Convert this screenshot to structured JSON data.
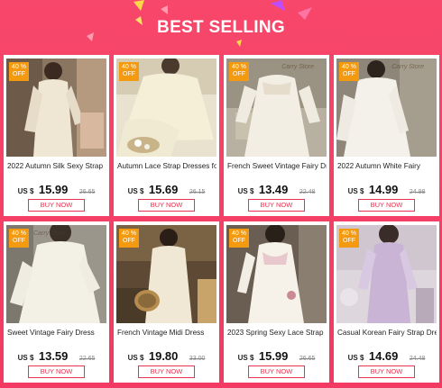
{
  "header": {
    "title": "BEST SELLING"
  },
  "watermark": "Carry Store",
  "currency": "US $",
  "buy_label": "BUY NOW",
  "colors": {
    "accent": "#f23a62",
    "badge": "#f39a10"
  },
  "products": [
    {
      "discount": "40 %",
      "off": "OFF",
      "name": "2022 Autumn Silk Sexy Strap",
      "price": "15.99",
      "old_price": "26.65"
    },
    {
      "discount": "40 %",
      "off": "OFF",
      "name": "Autumn Lace Strap Dresses for",
      "price": "15.69",
      "old_price": "26.15"
    },
    {
      "discount": "40 %",
      "off": "OFF",
      "name": "French Sweet Vintage Fairy Dress",
      "price": "13.49",
      "old_price": "22.48"
    },
    {
      "discount": "40 %",
      "off": "OFF",
      "name": "2022 Autumn White Fairy",
      "price": "14.99",
      "old_price": "24.98"
    },
    {
      "discount": "40 %",
      "off": "OFF",
      "name": "Sweet Vintage Fairy Dress",
      "price": "13.59",
      "old_price": "22.65"
    },
    {
      "discount": "40 %",
      "off": "OFF",
      "name": "French Vintage Midi Dress",
      "price": "19.80",
      "old_price": "33.00"
    },
    {
      "discount": "40 %",
      "off": "OFF",
      "name": "2023 Spring Sexy Lace Strap",
      "price": "15.99",
      "old_price": "26.65"
    },
    {
      "discount": "40 %",
      "off": "OFF",
      "name": "Casual Korean Fairy Strap Dress",
      "price": "14.69",
      "old_price": "24.48"
    }
  ]
}
